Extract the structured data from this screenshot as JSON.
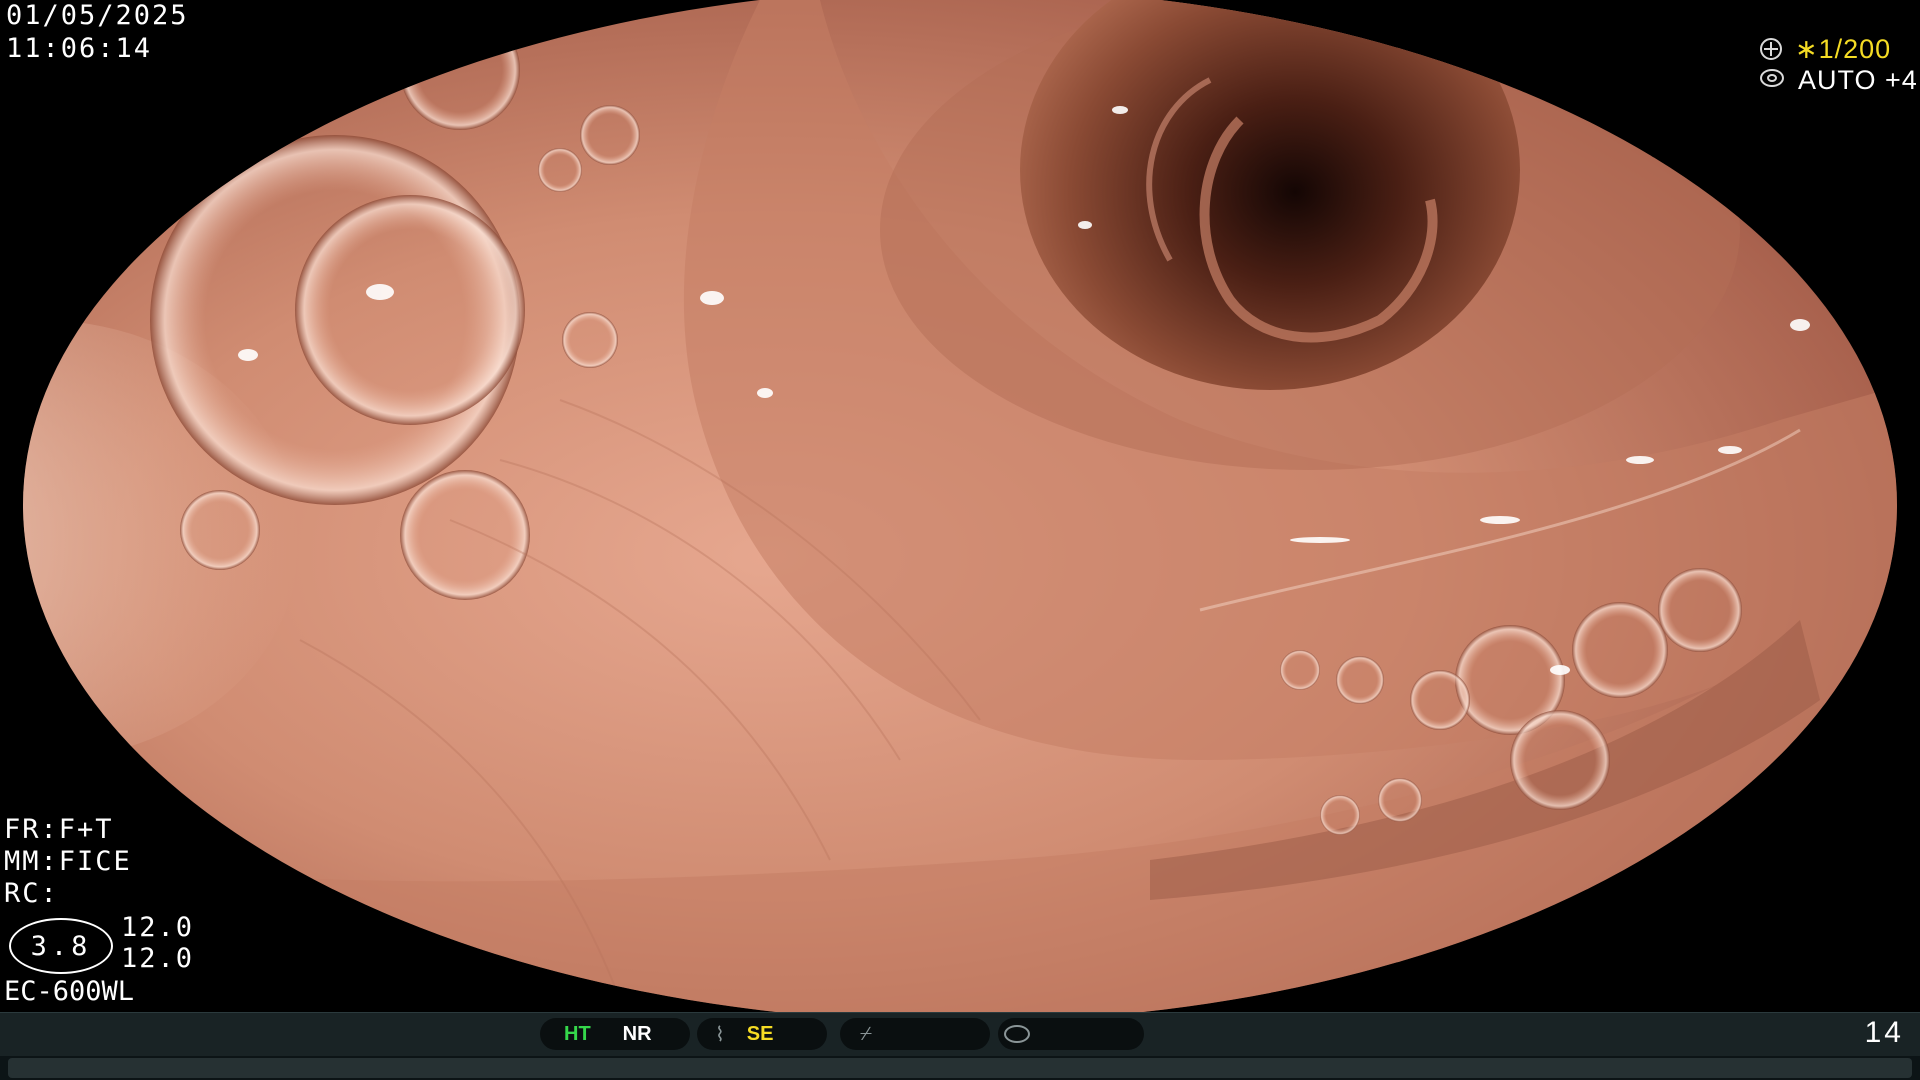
{
  "header": {
    "date": "01/05/2025",
    "time": "11:06:14"
  },
  "exposure": {
    "shutter": "∗1/200",
    "iris_mode": "AUTO +4",
    "shutter_icon": "aperture-icon",
    "iris_icon": "iris-icon"
  },
  "settings": {
    "fr": "FR:F+T",
    "mm": "MM:FICE",
    "rc": "RC:",
    "rc_value": "3.8",
    "value_1": "12.0",
    "value_2": "12.0",
    "scope_model": "EC-600WL"
  },
  "status_bar": {
    "ht": "HT",
    "nr": "NR",
    "se": "SE",
    "icons": [
      "contrast-icon",
      "enhance-icon",
      "color-mode-icon"
    ],
    "frame_number": "14"
  },
  "colors": {
    "osd_text": "#ffffff",
    "shutter_accent": "#f5dc24",
    "ht_active": "#35d84b",
    "se_accent": "#f5dc24",
    "status_bar_bg": "#192325"
  }
}
